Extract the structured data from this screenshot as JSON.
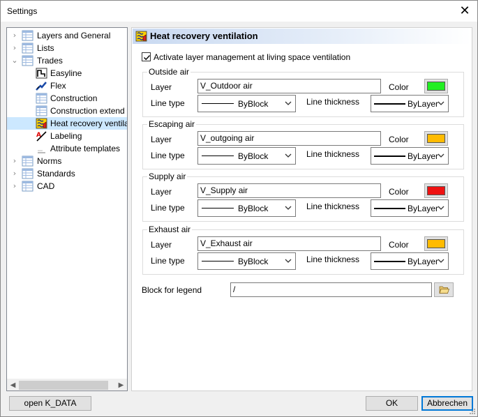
{
  "window": {
    "title": "Settings"
  },
  "tree": {
    "items": [
      {
        "label": "Layers and General",
        "chevron": "›",
        "icon": "table-icon"
      },
      {
        "label": "Lists",
        "chevron": "›",
        "icon": "table-icon"
      },
      {
        "label": "Trades",
        "chevron": "⌄",
        "icon": "table-icon"
      },
      {
        "label": "Easyline",
        "icon": "easyline-icon"
      },
      {
        "label": "Flex",
        "icon": "flex-icon"
      },
      {
        "label": "Construction",
        "icon": "table-icon"
      },
      {
        "label": "Construction extend",
        "icon": "table-icon"
      },
      {
        "label": "Heat recovery ventila",
        "icon": "ventilation-icon"
      },
      {
        "label": "Labeling",
        "icon": "labeling-icon"
      },
      {
        "label": "Attribute templates",
        "icon": "template-icon"
      },
      {
        "label": "Norms",
        "chevron": "›",
        "icon": "table-icon"
      },
      {
        "label": "Standards",
        "chevron": "›",
        "icon": "table-icon"
      },
      {
        "label": "CAD",
        "chevron": "›",
        "icon": "table-icon"
      }
    ]
  },
  "panel": {
    "title": "Heat recovery ventilation",
    "activate_label": "Activate layer management at living space ventilation",
    "activate_checked": true,
    "labels": {
      "layer": "Layer",
      "color": "Color",
      "line_type": "Line type",
      "line_thickness": "Line thickness"
    },
    "groups": [
      {
        "title": "Outside air",
        "layer": "V_Outdoor air",
        "color": "#22ee22",
        "line_type": "ByBlock",
        "line_thickness": "ByLayer"
      },
      {
        "title": "Escaping air",
        "layer": "V_outgoing air",
        "color": "#ffbb00",
        "line_type": "ByBlock",
        "line_thickness": "ByLayer"
      },
      {
        "title": "Supply air",
        "layer": "V_Supply air",
        "color": "#ee1111",
        "line_type": "ByBlock",
        "line_thickness": "ByLayer"
      },
      {
        "title": "Exhaust air",
        "layer": "V_Exhaust air",
        "color": "#ffbb00",
        "line_type": "ByBlock",
        "line_thickness": "ByLayer"
      }
    ],
    "legend": {
      "label": "Block for legend",
      "value": "/"
    }
  },
  "buttons": {
    "open_kdata": "open K_DATA",
    "ok": "OK",
    "cancel": "Abbrechen"
  }
}
